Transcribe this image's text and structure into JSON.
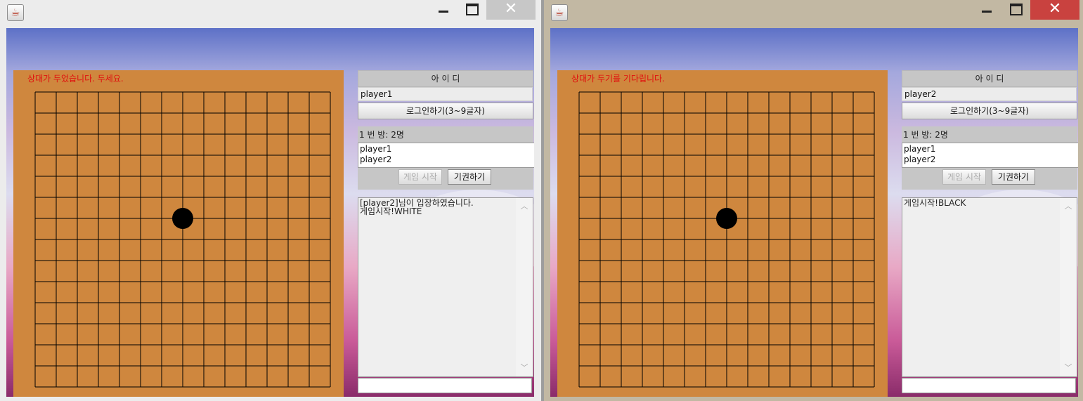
{
  "colors": {
    "board": "#cf873e",
    "status_text": "#e0120f",
    "stone": "#000000"
  },
  "windows": [
    {
      "status_message": "상대가 두었습니다. 두세요.",
      "id_label": "아 이 디",
      "id_value": "player1",
      "login_button": "로그인하기(3~9글자)",
      "room_label": "1 번 방: 2명",
      "users": [
        "player1",
        "player2"
      ],
      "start_button": "게임 시작",
      "surrender_button": "기권하기",
      "chat_lines": [
        "[player2]님이 입장하였습니다.",
        "게임시작!WHITE"
      ],
      "stones": [
        {
          "col": 7,
          "row": 6,
          "color": "black"
        }
      ]
    },
    {
      "status_message": "상대가 두기를 기다립니다.",
      "id_label": "아 이 디",
      "id_value": "player2",
      "login_button": "로그인하기(3~9글자)",
      "room_label": "1 번 방: 2명",
      "users": [
        "player1",
        "player2"
      ],
      "start_button": "게임 시작",
      "surrender_button": "기권하기",
      "chat_lines": [
        "게임시작!BLACK"
      ],
      "stones": [
        {
          "col": 7,
          "row": 6,
          "color": "black"
        }
      ]
    }
  ],
  "board": {
    "lines": 15
  },
  "icons": {
    "app": "java-cup-icon",
    "minimize": "minimize-icon",
    "maximize": "maximize-icon",
    "close": "close-icon",
    "close_glyph": "✕"
  }
}
